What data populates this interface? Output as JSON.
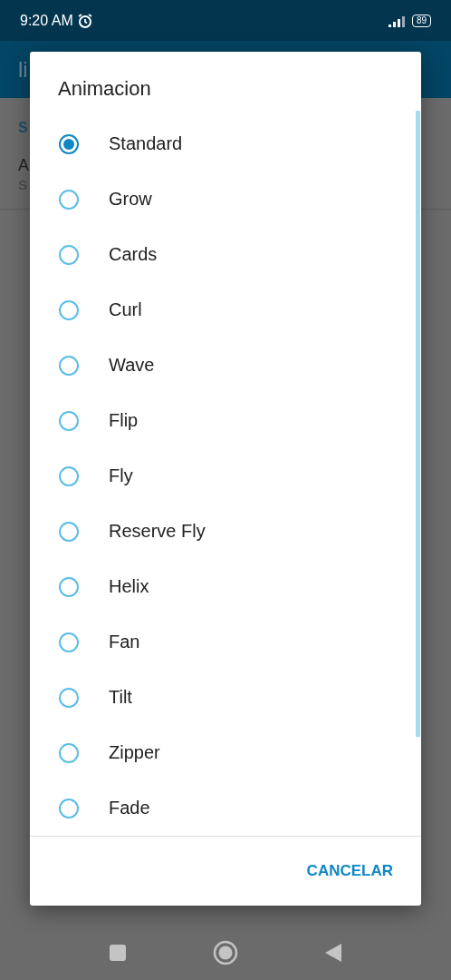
{
  "status_bar": {
    "time": "9:20 AM",
    "battery": "89"
  },
  "app_bar": {
    "title": "li"
  },
  "background": {
    "section": "S",
    "item_title": "A",
    "item_subtitle": "S"
  },
  "dialog": {
    "title": "Animacion",
    "options": [
      {
        "label": "Standard",
        "selected": true
      },
      {
        "label": "Grow",
        "selected": false
      },
      {
        "label": "Cards",
        "selected": false
      },
      {
        "label": "Curl",
        "selected": false
      },
      {
        "label": "Wave",
        "selected": false
      },
      {
        "label": "Flip",
        "selected": false
      },
      {
        "label": "Fly",
        "selected": false
      },
      {
        "label": "Reserve Fly",
        "selected": false
      },
      {
        "label": "Helix",
        "selected": false
      },
      {
        "label": "Fan",
        "selected": false
      },
      {
        "label": "Tilt",
        "selected": false
      },
      {
        "label": "Zipper",
        "selected": false
      },
      {
        "label": "Fade",
        "selected": false
      }
    ],
    "button": "CANCELAR"
  }
}
